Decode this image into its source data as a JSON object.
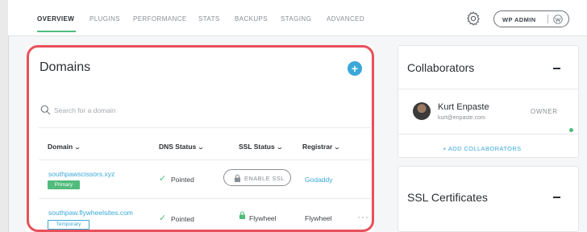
{
  "nav": {
    "tabs": [
      {
        "label": "OVERVIEW",
        "active": true
      },
      {
        "label": "PLUGINS"
      },
      {
        "label": "PERFORMANCE"
      },
      {
        "label": "STATS"
      },
      {
        "label": "BACKUPS"
      },
      {
        "label": "STAGING"
      },
      {
        "label": "ADVANCED"
      }
    ],
    "gear_icon": "gear-icon",
    "wp_admin_label": "WP ADMIN",
    "wp_icon": "wordpress-icon"
  },
  "domains": {
    "title": "Domains",
    "add_label": "+",
    "search_placeholder": "Search for a domain",
    "columns": [
      "Domain",
      "DNS Status",
      "SSL Status",
      "Registrar"
    ],
    "rows": [
      {
        "domain": "southpawscissors.xyz",
        "badge": "Primary",
        "dns_status": "Pointed",
        "ssl_status": "ENABLE SSL",
        "registrar": "Godaddy"
      },
      {
        "domain": "southpaw.flywheelsites.com",
        "badge": "Temporary",
        "dns_status": "Pointed",
        "ssl_status": "Flywheel",
        "registrar": "Flywheel",
        "more_label": "···"
      }
    ]
  },
  "collaborators": {
    "title": "Collaborators",
    "people": [
      {
        "name": "Kurt Enpaste",
        "email": "kurt@enpaste.com",
        "role": "OWNER"
      }
    ],
    "add_label": "+ ADD COLLABORATORS"
  },
  "ssl": {
    "title": "SSL Certificates"
  },
  "colors": {
    "accent_blue": "#3aa8d8",
    "accent_green": "#51bb7b",
    "highlight_red": "#e8505b"
  }
}
